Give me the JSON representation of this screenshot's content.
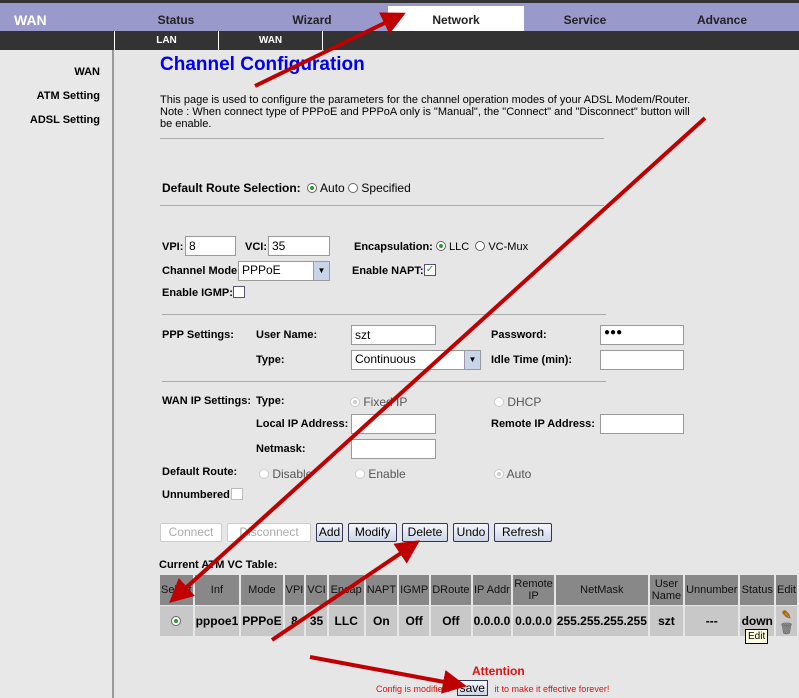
{
  "brand": "WAN",
  "tabs": [
    {
      "label": "Status"
    },
    {
      "label": "Wizard"
    },
    {
      "label": "Network",
      "active": true
    },
    {
      "label": "Service"
    },
    {
      "label": "Advance"
    }
  ],
  "subtabs": [
    {
      "label": "LAN"
    },
    {
      "label": "WAN"
    }
  ],
  "sidebar": [
    {
      "label": "WAN"
    },
    {
      "label": "ATM Setting"
    },
    {
      "label": "ADSL Setting"
    }
  ],
  "title": "Channel Configuration",
  "description": "This page is used to configure the parameters for the channel operation modes of your ADSL Modem/Router.",
  "note": "Note : When connect type of PPPoE and PPPoA only is \"Manual\", the \"Connect\" and \"Disconnect\" button will be enable.",
  "default_route_selection": {
    "label": "Default Route Selection:",
    "options": [
      "Auto",
      "Specified"
    ],
    "selected": "Auto"
  },
  "vpi": {
    "label": "VPI:",
    "value": "8"
  },
  "vci": {
    "label": "VCI:",
    "value": "35"
  },
  "encapsulation": {
    "label": "Encapsulation:",
    "options": [
      "LLC",
      "VC-Mux"
    ],
    "selected": "LLC"
  },
  "channel_mode": {
    "label": "Channel Mode:",
    "value": "PPPoE"
  },
  "enable_napt": {
    "label": "Enable NAPT:",
    "checked": true
  },
  "enable_igmp": {
    "label": "Enable IGMP:",
    "checked": false
  },
  "ppp": {
    "section": "PPP Settings:",
    "username_label": "User Name:",
    "username": "szt",
    "password_label": "Password:",
    "password": "●●●",
    "type_label": "Type:",
    "type": "Continuous",
    "idle_label": "Idle Time (min):",
    "idle": ""
  },
  "wanip": {
    "section": "WAN IP Settings:",
    "type_label": "Type:",
    "fixed": "Fixed IP",
    "dhcp": "DHCP",
    "local_label": "Local IP Address:",
    "remote_label": "Remote IP Address:",
    "netmask_label": "Netmask:"
  },
  "default_route": {
    "label": "Default Route:",
    "options": [
      "Disable",
      "Enable",
      "Auto"
    ],
    "selected": "Auto"
  },
  "unnumbered": {
    "label": "Unnumbered",
    "checked": false
  },
  "buttons": {
    "connect": "Connect",
    "disconnect": "Disconnect",
    "add": "Add",
    "modify": "Modify",
    "delete": "Delete",
    "undo": "Undo",
    "refresh": "Refresh"
  },
  "table": {
    "title": "Current ATM VC Table:",
    "headers": [
      "Select",
      "Inf",
      "Mode",
      "VPI",
      "VCI",
      "Encap",
      "NAPT",
      "IGMP",
      "DRoute",
      "IP Addr",
      "Remote IP",
      "NetMask",
      "User Name",
      "Unnumber",
      "Status",
      "Edit"
    ],
    "rows": [
      [
        "",
        "pppoe1",
        "PPPoE",
        "8",
        "35",
        "LLC",
        "On",
        "Off",
        "Off",
        "0.0.0.0",
        "0.0.0.0",
        "255.255.255.255",
        "szt",
        "---",
        "down",
        ""
      ]
    ]
  },
  "tooltip": "Edit",
  "attention": {
    "title": "Attention",
    "before": "Config is modified.",
    "save": "save",
    "after": "it to make it effective forever!"
  },
  "colors": {
    "nav": "#9999cc",
    "subnav": "#333333",
    "title": "#0000ee",
    "attention": "#e01010",
    "annotation_arrow": "#c00000"
  }
}
